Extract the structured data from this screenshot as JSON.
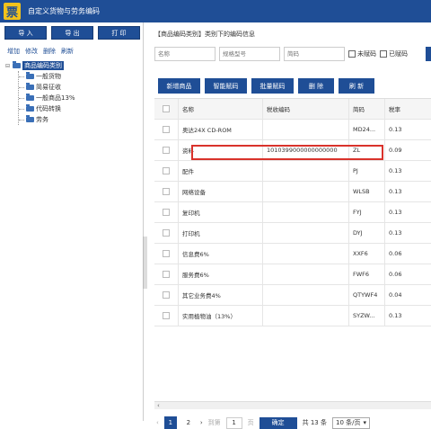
{
  "app": {
    "icon_glyph": "票",
    "title": "自定义货物与劳务编码"
  },
  "toolbar": {
    "import_label": "导 入",
    "export_label": "导 出",
    "print_label": "打 印"
  },
  "tree_actions": {
    "add": "增加",
    "edit": "修改",
    "delete": "删除",
    "refresh": "刷新"
  },
  "tree": {
    "root_expander": "⊟",
    "root_label": "商品编码类别",
    "children": [
      "一般货物",
      "简易征收",
      "一般商品13%",
      "代码转换",
      "劳务"
    ]
  },
  "category_info": "【商品编码类别】类别下的编码信息",
  "filters": {
    "name_placeholder": "名称",
    "spec_placeholder": "规格型号",
    "shortcode_placeholder": "简码",
    "unassigned_label": "未赋码",
    "assigned_label": "已赋码"
  },
  "actions": {
    "add": "新增商品",
    "smart_assign": "智能赋码",
    "batch_assign": "批量赋码",
    "delete": "删  除",
    "refresh": "刷  新"
  },
  "table": {
    "headers": {
      "name": "名称",
      "tax_code": "税收编码",
      "short_code": "简码",
      "rate": "税率"
    },
    "rows": [
      {
        "name": "奥达24X CD-ROM",
        "tax_code": "",
        "short_code": "MD24...",
        "rate": "0.13"
      },
      {
        "name": "资料",
        "tax_code": "1010399000000000000",
        "short_code": "ZL",
        "rate": "0.09"
      },
      {
        "name": "配件",
        "tax_code": "",
        "short_code": "PJ",
        "rate": "0.13"
      },
      {
        "name": "网络设备",
        "tax_code": "",
        "short_code": "WLSB",
        "rate": "0.13"
      },
      {
        "name": "复印机",
        "tax_code": "",
        "short_code": "FYJ",
        "rate": "0.13"
      },
      {
        "name": "打印机",
        "tax_code": "",
        "short_code": "DYJ",
        "rate": "0.13"
      },
      {
        "name": "信息费6%",
        "tax_code": "",
        "short_code": "XXF6",
        "rate": "0.06"
      },
      {
        "name": "服务费6%",
        "tax_code": "",
        "short_code": "FWF6",
        "rate": "0.06"
      },
      {
        "name": "其它业务费4%",
        "tax_code": "",
        "short_code": "QTYWF4",
        "rate": "0.04"
      },
      {
        "name": "实用植物油（13%）",
        "tax_code": "",
        "short_code": "SYZW...",
        "rate": "0.13"
      }
    ]
  },
  "pager": {
    "prev": "‹",
    "page1": "1",
    "page2": "2",
    "next": "›",
    "goto_label": "到第",
    "goto_value": "1",
    "page_unit": "页",
    "confirm": "确定",
    "total": "共 13 条",
    "page_size": "10 条/页",
    "dropdown": "▾"
  },
  "colors": {
    "primary": "#1f4e96",
    "highlight": "#d9322b",
    "icon": "#f2c21b"
  }
}
